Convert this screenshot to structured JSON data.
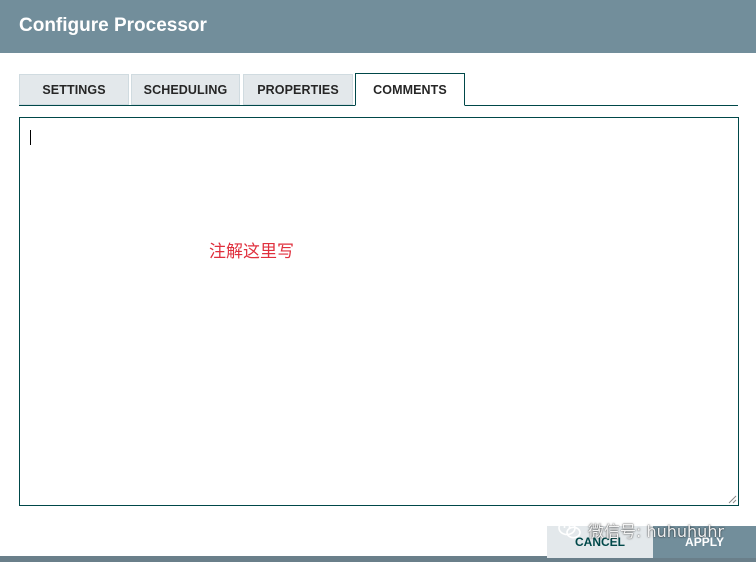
{
  "dialog": {
    "title": "Configure Processor"
  },
  "tabs": [
    {
      "label": "SETTINGS",
      "active": false
    },
    {
      "label": "SCHEDULING",
      "active": false
    },
    {
      "label": "PROPERTIES",
      "active": false
    },
    {
      "label": "COMMENTS",
      "active": true
    }
  ],
  "comments": {
    "value": "",
    "annotation": "注解这里写"
  },
  "buttons": {
    "cancel_label": "CANCEL",
    "apply_label": "APPLY"
  },
  "watermark": {
    "text": "微信号: huhuhuhr",
    "icon": "wechat-icon"
  },
  "colors": {
    "header": "#728e9b",
    "accent": "#004849",
    "annotation": "#e0303e",
    "tab_inactive": "#e3e8eb"
  }
}
